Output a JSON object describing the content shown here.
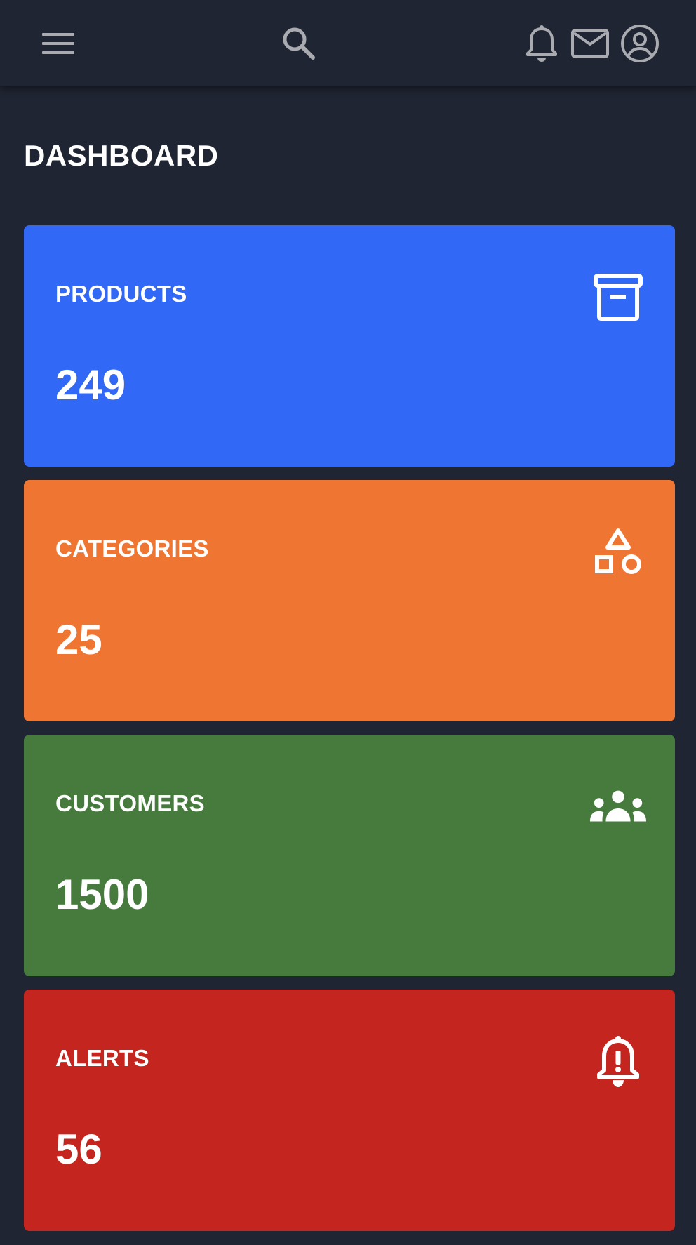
{
  "header": {
    "menu_icon": "menu-icon",
    "search_icon": "search-icon",
    "notifications_icon": "bell-icon",
    "messages_icon": "mail-icon",
    "account_icon": "account-circle-icon",
    "icon_color": "#a9abb1",
    "background": "#1f2532"
  },
  "page": {
    "title": "DASHBOARD"
  },
  "cards": [
    {
      "label": "PRODUCTS",
      "value": "249",
      "icon": "archive-icon",
      "color": "#3268f6"
    },
    {
      "label": "CATEGORIES",
      "value": "25",
      "icon": "shapes-icon",
      "color": "#ef7532"
    },
    {
      "label": "CUSTOMERS",
      "value": "1500",
      "icon": "people-icon",
      "color": "#477b3d"
    },
    {
      "label": "ALERTS",
      "value": "56",
      "icon": "notification-important-icon",
      "color": "#c4251e"
    }
  ]
}
